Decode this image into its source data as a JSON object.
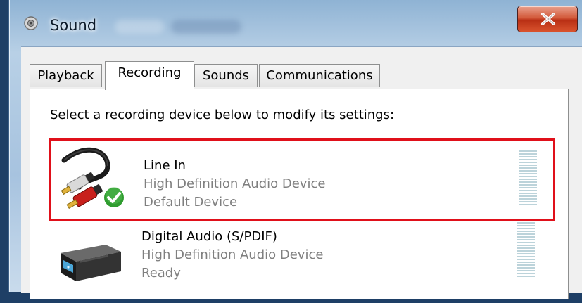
{
  "window": {
    "title": "Sound",
    "title_icon": "speaker-icon",
    "close_icon": "close-icon"
  },
  "tabs": [
    {
      "label": "Playback",
      "active": false
    },
    {
      "label": "Recording",
      "active": true
    },
    {
      "label": "Sounds",
      "active": false
    },
    {
      "label": "Communications",
      "active": false
    }
  ],
  "recording": {
    "instruction": "Select a recording device below to modify its settings:",
    "devices": [
      {
        "name": "Line In",
        "description": "High Definition Audio Device",
        "status": "Default Device",
        "icon": "rca-cable-icon",
        "default_badge": "green-check-icon",
        "selected": true
      },
      {
        "name": "Digital Audio (S/PDIF)",
        "description": "High Definition Audio Device",
        "status": "Ready",
        "icon": "digital-receiver-icon",
        "selected": false
      }
    ]
  },
  "colors": {
    "selection_border": "#e0101a",
    "close_button": "#c83b1e",
    "level_meter": "#bcd3da",
    "secondary_text": "#7f7f7f"
  }
}
